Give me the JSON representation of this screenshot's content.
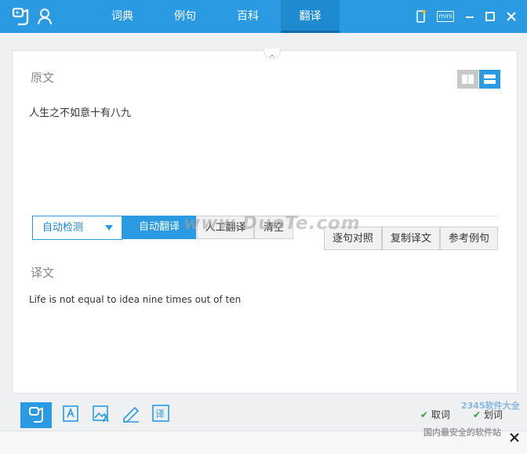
{
  "nav": {
    "tabs": [
      {
        "label": "词典"
      },
      {
        "label": "例句"
      },
      {
        "label": "百科"
      },
      {
        "label": "翻译"
      }
    ],
    "active_index": 3
  },
  "window": {
    "mini_label": "mini"
  },
  "source": {
    "heading": "原文",
    "text": "人生之不如意十有八九"
  },
  "toolbar": {
    "detect_label": "自动检测",
    "auto_translate_label": "自动翻译",
    "human_translate_label": "人工翻译",
    "clear_label": "清空",
    "compare_label": "逐句对照",
    "copy_label": "复制译文",
    "ref_label": "参考例句"
  },
  "result": {
    "heading": "译文",
    "text": "Life is not equal to idea nine times out of ten"
  },
  "bottom": {
    "cancel_label": "取词",
    "select_label": "划词"
  },
  "watermarks": {
    "center": "www.DuoTe.com",
    "corner_logo": "2345软件大全",
    "corner_text": "国内最安全的软件站"
  },
  "colors": {
    "accent": "#2a9be2",
    "accent_dark": "#1e8ad0"
  }
}
